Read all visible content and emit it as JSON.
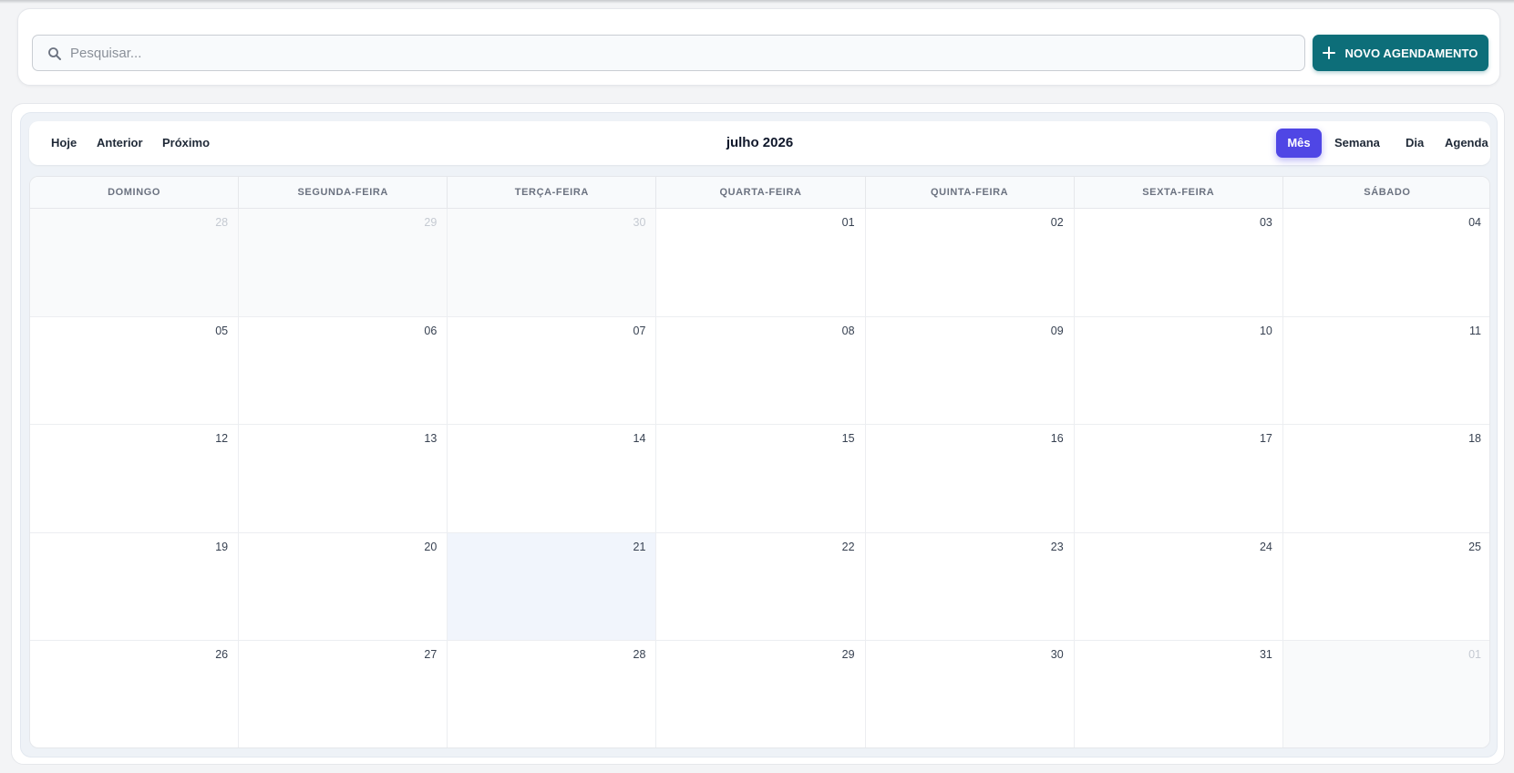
{
  "search": {
    "placeholder": "Pesquisar...",
    "value": ""
  },
  "actions": {
    "new_label": "NOVO AGENDAMENTO"
  },
  "colors": {
    "primary": "#0d6e79",
    "view_active": "#4f46e5",
    "today_bg": "#f1f5fc"
  },
  "toolbar": {
    "today": "Hoje",
    "prev": "Anterior",
    "next": "Próximo",
    "title": "julho 2026",
    "views": [
      "Mês",
      "Semana",
      "Dia",
      "Agenda"
    ],
    "active_view": "Mês"
  },
  "weekdays": [
    "DOMINGO",
    "SEGUNDA-FEIRA",
    "TERÇA-FEIRA",
    "QUARTA-FEIRA",
    "QUINTA-FEIRA",
    "SEXTA-FEIRA",
    "SÁBADO"
  ],
  "weeks": [
    [
      {
        "n": "28",
        "off": true
      },
      {
        "n": "29",
        "off": true
      },
      {
        "n": "30",
        "off": true
      },
      {
        "n": "01"
      },
      {
        "n": "02"
      },
      {
        "n": "03"
      },
      {
        "n": "04"
      }
    ],
    [
      {
        "n": "05"
      },
      {
        "n": "06"
      },
      {
        "n": "07"
      },
      {
        "n": "08"
      },
      {
        "n": "09"
      },
      {
        "n": "10"
      },
      {
        "n": "11"
      }
    ],
    [
      {
        "n": "12"
      },
      {
        "n": "13"
      },
      {
        "n": "14"
      },
      {
        "n": "15"
      },
      {
        "n": "16"
      },
      {
        "n": "17"
      },
      {
        "n": "18"
      }
    ],
    [
      {
        "n": "19"
      },
      {
        "n": "20"
      },
      {
        "n": "21",
        "today": true
      },
      {
        "n": "22"
      },
      {
        "n": "23"
      },
      {
        "n": "24"
      },
      {
        "n": "25"
      }
    ],
    [
      {
        "n": "26"
      },
      {
        "n": "27"
      },
      {
        "n": "28"
      },
      {
        "n": "29"
      },
      {
        "n": "30"
      },
      {
        "n": "31"
      },
      {
        "n": "01",
        "off": true
      }
    ]
  ]
}
